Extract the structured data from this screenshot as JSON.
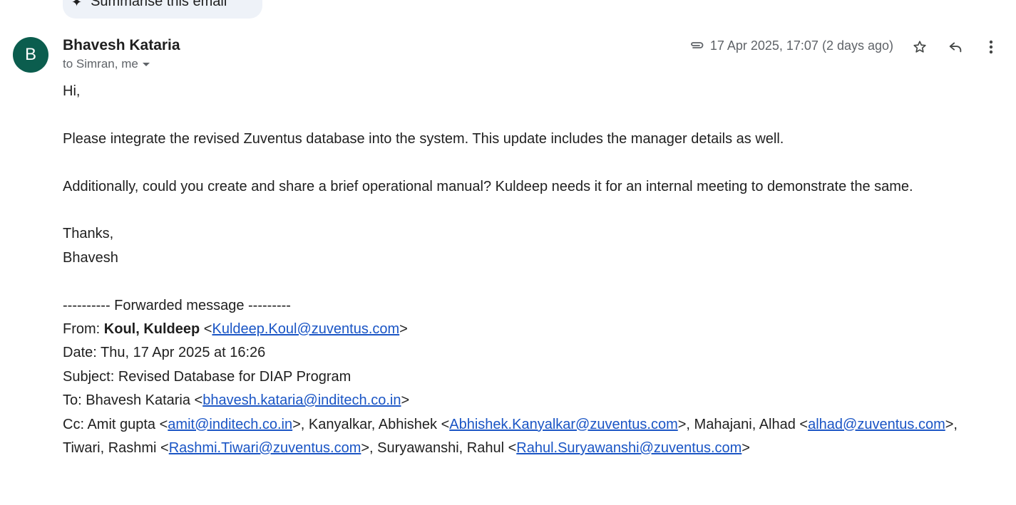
{
  "summarise": {
    "label": "Summarise this email"
  },
  "email": {
    "avatar_letter": "B",
    "sender_name": "Bhavesh Kataria",
    "recipients": "to Simran, me",
    "datetime": "17 Apr 2025, 17:07 (2 days ago)",
    "body": {
      "greeting": "Hi,",
      "para1": "Please integrate the revised Zuventus database into the system. This update includes the manager details as well.",
      "para2": "Additionally, could you create and share a brief operational manual? Kuldeep needs it for an internal meeting to demonstrate the same.",
      "thanks": "Thanks,",
      "signature": "Bhavesh"
    },
    "forwarded": {
      "header": "---------- Forwarded message ---------",
      "from_label": "From: ",
      "from_name": "Koul, Kuldeep",
      "from_email": "Kuldeep.Koul@zuventus.com",
      "date_line": "Date: Thu, 17 Apr 2025 at 16:26",
      "subject_line": "Subject: Revised Database for DIAP Program",
      "to_label": "To: Bhavesh Kataria <",
      "to_email": "bhavesh.kataria@inditech.co.in",
      "cc": [
        {
          "prefix": "Cc: Amit gupta <",
          "email": "amit@inditech.co.in"
        },
        {
          "prefix": ">, Kanyalkar, Abhishek <",
          "email": "Abhishek.Kanyalkar@zuventus.com"
        },
        {
          "prefix": ">, Mahajani, Alhad <",
          "email": "alhad@zuventus.com"
        },
        {
          "prefix": ">, Tiwari, Rashmi <",
          "email": "Rashmi.Tiwari@zuventus.com"
        },
        {
          "prefix": ">, Suryawanshi, Rahul <",
          "email": "Rahul.Suryawanshi@zuventus.com"
        }
      ],
      "cc_end": ">"
    }
  },
  "colors": {
    "avatar": "#0b5d4e",
    "link": "#1a55c5",
    "chip": "#eef2f8"
  }
}
